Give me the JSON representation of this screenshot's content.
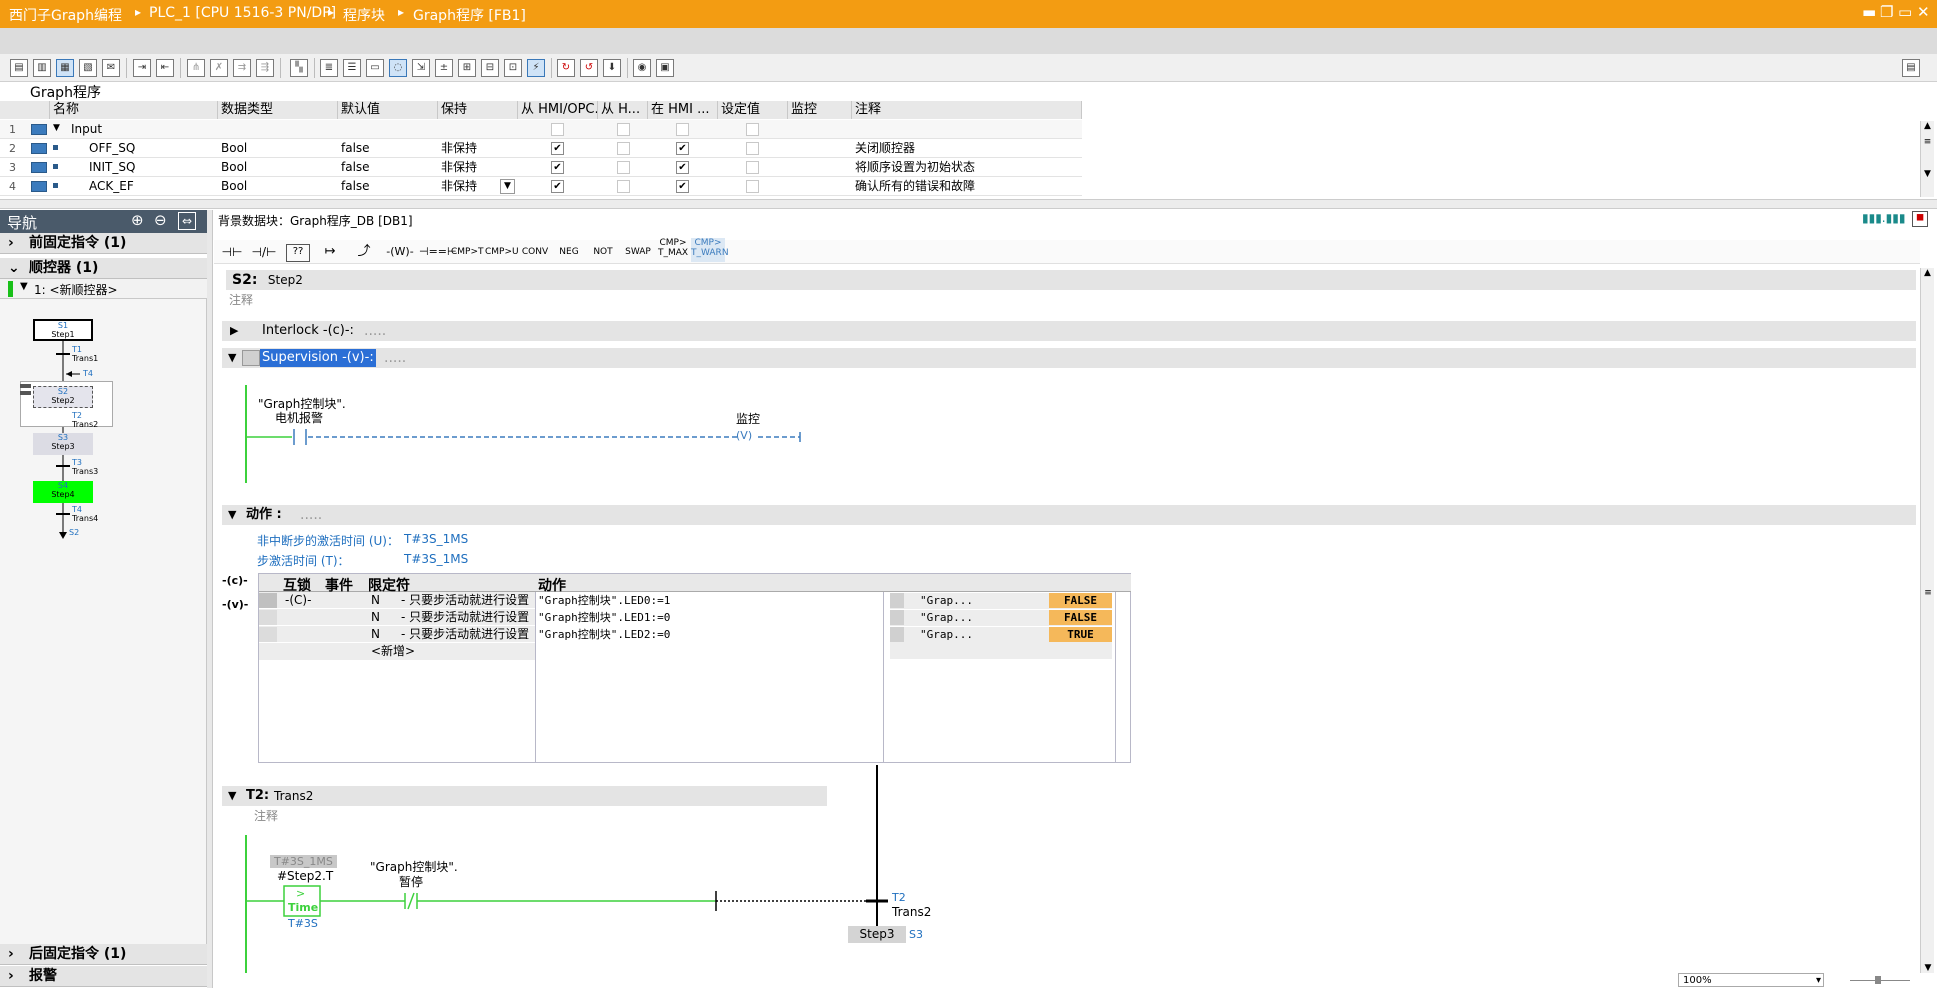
{
  "breadcrumb": {
    "items": [
      "西门子Graph编程",
      "PLC_1 [CPU 1516-3 PN/DP]",
      "程序块",
      "Graph程序 [FB1]"
    ]
  },
  "block_title": "Graph程序",
  "interface": {
    "headers": [
      "名称",
      "数据类型",
      "默认值",
      "保持",
      "从 HMI/OPC...",
      "从 H...",
      "在 HMI ...",
      "设定值",
      "监控",
      "注释"
    ],
    "rows": [
      {
        "num": "1",
        "name": "Input",
        "type": "",
        "default": "",
        "retain": "",
        "c1": false,
        "c2": false,
        "c3": false,
        "comment": ""
      },
      {
        "num": "2",
        "name": "OFF_SQ",
        "type": "Bool",
        "default": "false",
        "retain": "非保持",
        "c1": true,
        "c2": false,
        "c3": true,
        "comment": "关闭顺控器"
      },
      {
        "num": "3",
        "name": "INIT_SQ",
        "type": "Bool",
        "default": "false",
        "retain": "非保持",
        "c1": true,
        "c2": false,
        "c3": true,
        "comment": "将顺序设置为初始状态"
      },
      {
        "num": "4",
        "name": "ACK_EF",
        "type": "Bool",
        "default": "false",
        "retain": "非保持",
        "c1": true,
        "c2": false,
        "c3": true,
        "comment": "确认所有的错误和故障"
      }
    ]
  },
  "nav": {
    "title": "导航",
    "sections": [
      "前固定指令 (1)",
      "顺控器 (1)"
    ],
    "sequencer": "1: <新顺控器>",
    "bottom_sections": [
      "后固定指令 (1)",
      "报警"
    ],
    "graph": {
      "steps": [
        {
          "num": "S1",
          "name": "Step1"
        },
        {
          "num": "S2",
          "name": "Step2"
        },
        {
          "num": "S3",
          "name": "Step3"
        },
        {
          "num": "S4",
          "name": "Step4"
        }
      ],
      "transitions": [
        {
          "num": "T1",
          "name": "Trans1"
        },
        {
          "num": "T2",
          "name": "Trans2"
        },
        {
          "num": "T3",
          "name": "Trans3"
        },
        {
          "num": "T4",
          "name": "Trans4"
        }
      ],
      "jump_in": "T4",
      "jump_out": "S2"
    }
  },
  "editor": {
    "instance_db": "背景数据块：Graph程序_DB [DB1]",
    "instructions": [
      "CMP>T",
      "CMP>U",
      "CONV",
      "NEG",
      "NOT",
      "SWAP",
      "CMP> T_MAX",
      "CMP> T_WARN"
    ],
    "step_id": "S2:",
    "step_name": "Step2",
    "comment_label": "注释",
    "interlock": "Interlock -(c)-:",
    "supervision": "Supervision -(v)-:",
    "ellipsis": ".....",
    "supervision_net": {
      "contact_label_1": "\"Graph控制块\".",
      "contact_label_2": "电机报警",
      "coil_label": "监控",
      "coil": "V"
    },
    "actions_title": "动作 :",
    "non_interrupt_label": "非中断步的激活时间 (U)：",
    "non_interrupt_value": "T#3S_1MS",
    "activation_label": "步激活时间 (T)：",
    "activation_value": "T#3S_1MS",
    "side_c": "-(c)-",
    "side_v": "-(v)-",
    "action_headers": [
      "互锁",
      "事件",
      "限定符",
      "动作"
    ],
    "actions": [
      {
        "interlock": "-(C)-",
        "qualifier": "N",
        "qual_desc": "- 只要步活动就进行设置",
        "action": "\"Graph控制块\".LED0:=1",
        "mon": "\"Grap...",
        "value": "FALSE"
      },
      {
        "interlock": "",
        "qualifier": "N",
        "qual_desc": "- 只要步活动就进行设置",
        "action": "\"Graph控制块\".LED1:=0",
        "mon": "\"Grap...",
        "value": "FALSE"
      },
      {
        "interlock": "",
        "qualifier": "N",
        "qual_desc": "- 只要步活动就进行设置",
        "action": "\"Graph控制块\".LED2:=0",
        "mon": "\"Grap...",
        "value": "TRUE"
      }
    ],
    "add_new": "<新增>",
    "transition_id": "T2:",
    "transition_name": "Trans2",
    "trans_net": {
      "time_value": "T#3S_1MS",
      "time_var": "#Step2.T",
      "cmp_sym": ">",
      "cmp_type": "Time",
      "cmp_in2": "T#3S",
      "contact_label_1": "\"Graph控制块\".",
      "contact_label_2": "暂停",
      "trans_num": "T2",
      "trans_name": "Trans2",
      "next_step": "Step3",
      "next_step_num": "S3"
    }
  },
  "status": {
    "zoom": "100%"
  },
  "colors": {
    "titlebar": "#f39c12",
    "nav_header": "#4a5a6a",
    "active_step": "#00ff00",
    "value_highlight": "#f5b85a",
    "signal_green": "#3cd13c",
    "link_blue": "#1f6fbf"
  }
}
